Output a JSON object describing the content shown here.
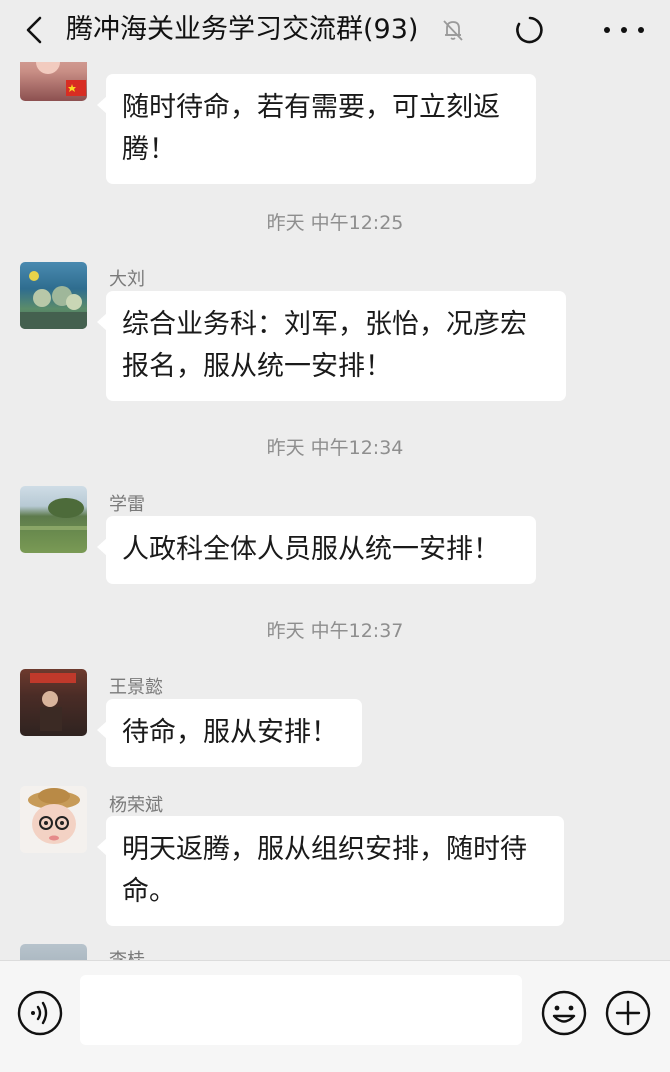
{
  "header": {
    "title": "腾冲海关业务学习交流群(93)",
    "icons": [
      "back-icon",
      "mute-bell-icon",
      "loading-icon",
      "more-icon"
    ]
  },
  "messages": [
    {
      "sender": "",
      "text": "随时待命，若有需要，可立刻返腾！"
    },
    {
      "sender": "大刘",
      "text": "综合业务科：刘军，张怡，况彦宏报名，服从统一安排！"
    },
    {
      "sender": "学雷",
      "text": "人政科全体人员服从统一安排！"
    },
    {
      "sender": "王景懿",
      "text": "待命，服从安排！"
    },
    {
      "sender": "杨荣斌",
      "text": "明天返腾，服从组织安排，随时待命。"
    },
    {
      "sender": "李桂",
      "text": ""
    }
  ],
  "timestamps": [
    "昨天 中午12:25",
    "昨天 中午12:34",
    "昨天 中午12:37"
  ],
  "footer": {
    "icons": [
      "voice-icon",
      "emoji-icon",
      "plus-icon"
    ]
  }
}
